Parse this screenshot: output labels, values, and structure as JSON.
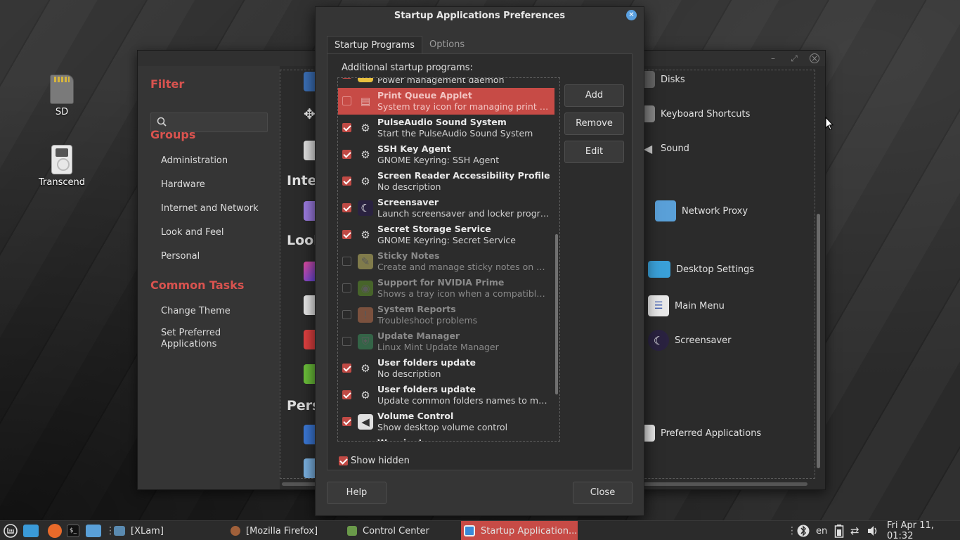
{
  "desktop": {
    "icons": [
      {
        "label": "SD"
      },
      {
        "label": "Transcend"
      }
    ]
  },
  "control_center": {
    "filter_heading": "Filter",
    "search_placeholder": "",
    "groups_heading": "Groups",
    "groups": [
      "Administration",
      "Hardware",
      "Internet and Network",
      "Look and Feel",
      "Personal"
    ],
    "common_tasks_heading": "Common Tasks",
    "tasks": [
      "Change Theme",
      "Set Preferred",
      "Applications"
    ],
    "sections": [
      "Inter",
      "Look",
      "Pers"
    ],
    "tiles": [
      "Disks",
      "Keyboard Shortcuts",
      "Sound",
      "Network Proxy",
      "Desktop Settings",
      "Main Menu",
      "Screensaver",
      "Preferred Applications"
    ]
  },
  "dialog": {
    "title": "Startup Applications Preferences",
    "tabs": [
      "Startup Programs",
      "Options"
    ],
    "additional_label": "Additional startup programs:",
    "buttons": {
      "add": "Add",
      "remove": "Remove",
      "edit": "Edit",
      "help": "Help",
      "close": "Close"
    },
    "show_hidden": "Show hidden",
    "items": [
      {
        "name": "",
        "desc": "Power management daemon",
        "enabled": true,
        "icon": "power-icon"
      },
      {
        "name": "Print Queue Applet",
        "desc": "System tray icon for managing print jobs",
        "enabled": false,
        "icon": "printer-icon",
        "selected": true
      },
      {
        "name": "PulseAudio Sound System",
        "desc": "Start the PulseAudio Sound System",
        "enabled": true,
        "icon": "gears-icon"
      },
      {
        "name": "SSH Key Agent",
        "desc": "GNOME Keyring: SSH Agent",
        "enabled": true,
        "icon": "gears-icon"
      },
      {
        "name": "Screen Reader Accessibility Profile",
        "desc": "No description",
        "enabled": true,
        "icon": "gears-icon"
      },
      {
        "name": "Screensaver",
        "desc": "Launch screensaver and locker program",
        "enabled": true,
        "icon": "moon-icon"
      },
      {
        "name": "Secret Storage Service",
        "desc": "GNOME Keyring: Secret Service",
        "enabled": true,
        "icon": "gears-icon"
      },
      {
        "name": "Sticky Notes",
        "desc": "Create and manage sticky notes on yo...",
        "enabled": false,
        "icon": "note-icon"
      },
      {
        "name": "Support for NVIDIA Prime",
        "desc": "Shows a tray icon when a compatible ...",
        "enabled": false,
        "icon": "nvidia-icon"
      },
      {
        "name": "System Reports",
        "desc": "Troubleshoot problems",
        "enabled": false,
        "icon": "report-icon"
      },
      {
        "name": "Update Manager",
        "desc": "Linux Mint Update Manager",
        "enabled": false,
        "icon": "shield-icon"
      },
      {
        "name": "User folders update",
        "desc": "No description",
        "enabled": true,
        "icon": "gears-icon"
      },
      {
        "name": "User folders update",
        "desc": "Update common folders names to mat...",
        "enabled": true,
        "icon": "gears-icon"
      },
      {
        "name": "Volume Control",
        "desc": "Show desktop volume control",
        "enabled": true,
        "icon": "speaker-icon"
      },
      {
        "name": "Warpinator",
        "desc": "",
        "enabled": true,
        "icon": "gears-icon"
      }
    ]
  },
  "taskbar": {
    "windows": [
      {
        "label": "[XLam]"
      },
      {
        "label": "[Mozilla Firefox]"
      },
      {
        "label": "Control Center"
      },
      {
        "label": "Startup Application..."
      }
    ],
    "keyboard_layout": "en",
    "clock": "Fri Apr 11, 01:32"
  }
}
